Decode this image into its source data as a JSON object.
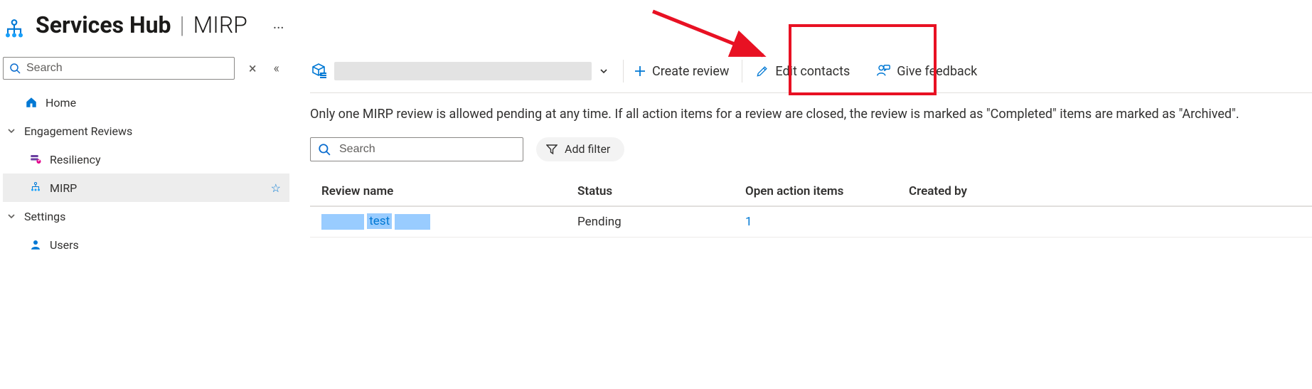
{
  "header": {
    "title_strong": "Services Hub",
    "title_thin": "MIRP",
    "more_label": "···"
  },
  "sidebar": {
    "search_placeholder": "Search",
    "clear_symbol": "×",
    "collapse_symbol": "«",
    "home_label": "Home",
    "engagement_label": "Engagement Reviews",
    "resiliency_label": "Resiliency",
    "mirp_label": "MIRP",
    "settings_label": "Settings",
    "users_label": "Users"
  },
  "toolbar": {
    "create_review_label": "Create review",
    "edit_contacts_label": "Edit contacts",
    "give_feedback_label": "Give feedback"
  },
  "info_text": "Only one MIRP review is allowed pending at any time. If all action items for a review are closed, the review is marked as \"Completed\" items are marked as \"Archived\".",
  "filter": {
    "search_placeholder": "Search",
    "add_filter_label": "Add filter"
  },
  "table": {
    "columns": {
      "name": "Review name",
      "status": "Status",
      "open": "Open action items",
      "created": "Created by"
    },
    "rows": [
      {
        "name_visible": "test",
        "status": "Pending",
        "open_items": "1"
      }
    ]
  }
}
